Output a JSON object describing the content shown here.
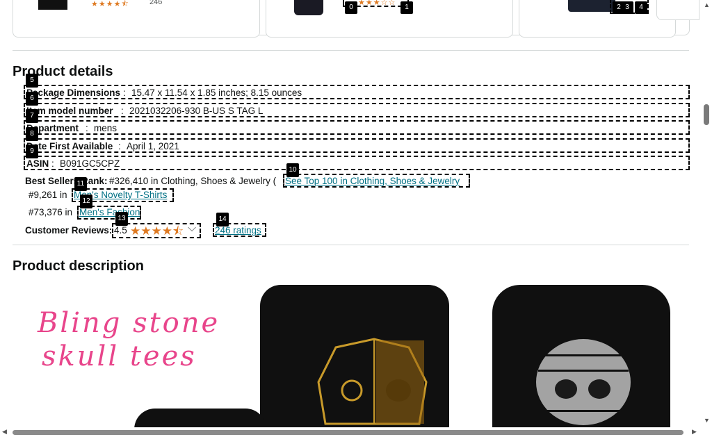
{
  "carousel": {
    "card1_count": "246",
    "card1_stars": "★★★★⯪",
    "card2_stars": "★★★☆☆",
    "card2_markers": [
      "0",
      "1"
    ],
    "card3_markers": [
      "2",
      "3",
      "4"
    ]
  },
  "product_details": {
    "heading": "Product details",
    "rows": [
      {
        "marker": "5",
        "key": "Package Dimensions",
        "sep": ":",
        "value": "15.47 x 11.54 x 1.85 inches; 8.15 ounces"
      },
      {
        "marker": "6",
        "key": "Item model number",
        "sep": ":",
        "value": "2021032206-930 B-US S TAG L"
      },
      {
        "marker": "7",
        "key": "Department",
        "sep": ":",
        "value": "mens"
      },
      {
        "marker": "8",
        "key": "Date First Available",
        "sep": ":",
        "value": "April 1, 2021"
      },
      {
        "marker": "9",
        "key": "ASIN",
        "sep": ":",
        "value": "B091GC5CPZ"
      }
    ],
    "best_sellers": {
      "label": "Best Sellers Rank:",
      "rank_text": "#326,410 in Clothing, Shoes & Jewelry (",
      "top100_link": "See Top 100 in Clothing, Shoes & Jewelry",
      "top100_marker": "10",
      "sub1_rank": "#9,261 in",
      "sub1_link": "Men's Novelty T-Shirts",
      "sub1_marker": "11",
      "sub2_rank": "#73,376 in",
      "sub2_link": "Men's Fashion",
      "sub2_marker": "12"
    },
    "reviews": {
      "label": "Customer Reviews:",
      "rating": "4.5",
      "stars": "★★★★⯪",
      "stars_marker": "13",
      "ratings_link": "246 ratings",
      "ratings_marker": "14",
      "chevron": "⌵"
    }
  },
  "product_description": {
    "heading": "Product description",
    "image_text_line1": "Bling stone",
    "image_text_line2": "skull tees"
  },
  "colors": {
    "link": "#007185",
    "star": "#de7921",
    "script_pink": "#e8458b"
  }
}
